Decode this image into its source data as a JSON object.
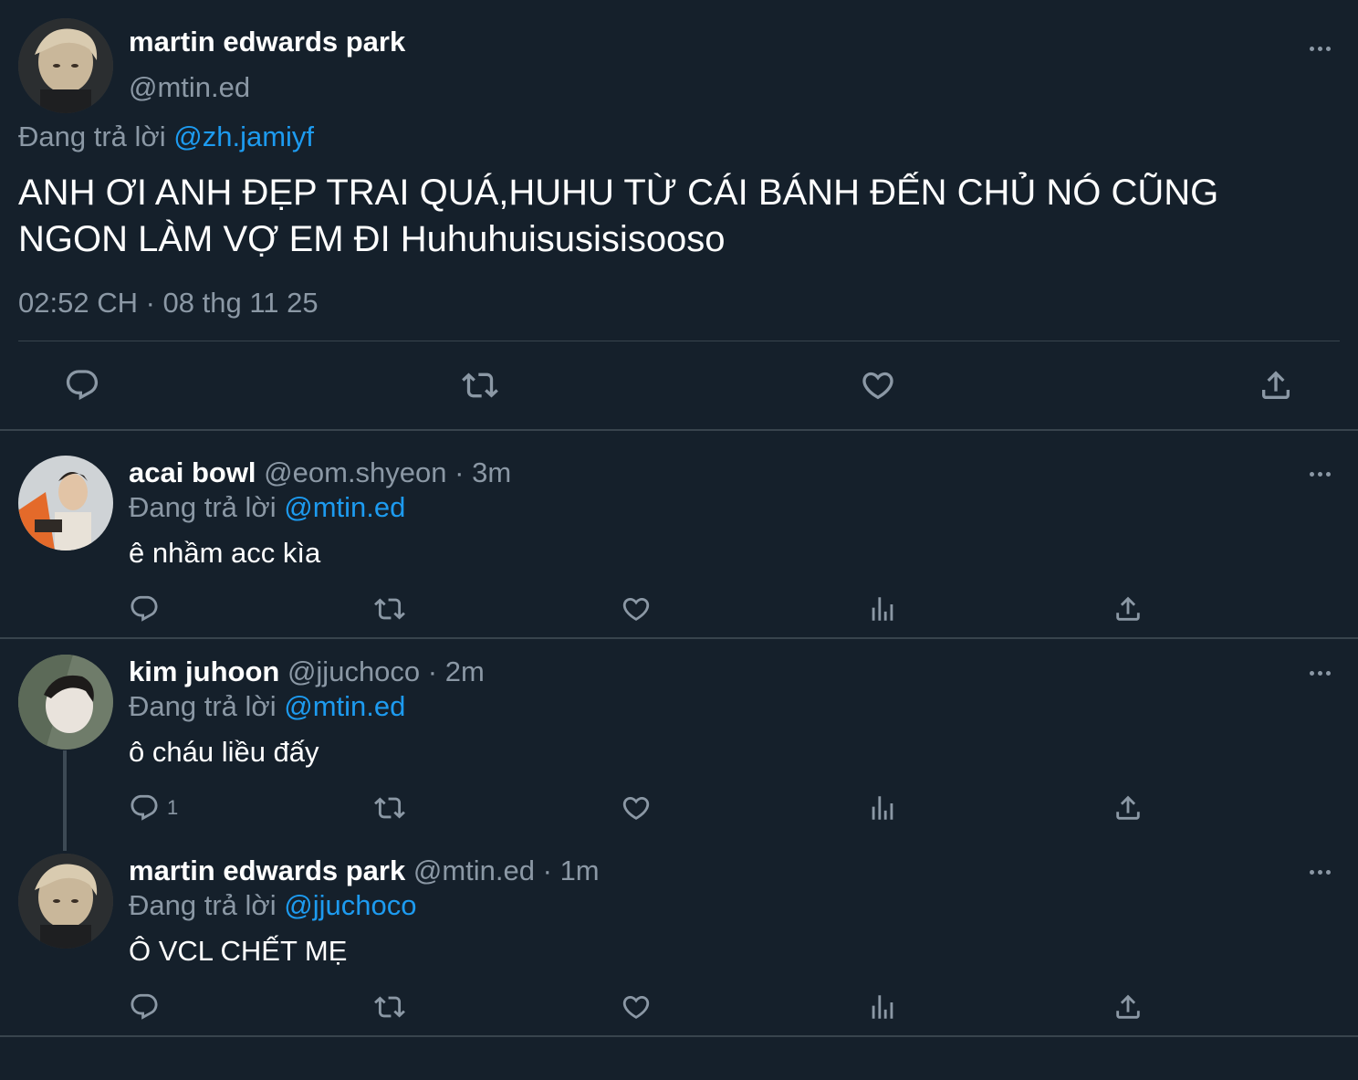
{
  "main_tweet": {
    "author_name": "martin edwards park",
    "author_handle": "@mtin.ed",
    "replying_prefix": "Đang trả lời",
    "replying_to": "@zh.jamiyf",
    "text": "ANH ƠI ANH ĐẸP TRAI QUÁ,HUHU TỪ CÁI BÁNH ĐẾN CHỦ NÓ CŨNG NGON LÀM VỢ EM ĐI Huhuhuisusisisooso",
    "timestamp": "02:52 CH · 08 thg 11 25",
    "actions": [
      "reply-icon",
      "retweet-icon",
      "like-icon",
      "share-icon"
    ]
  },
  "replies": [
    {
      "author_name": "acai bowl",
      "author_handle": "@eom.shyeon",
      "sep": "·",
      "age": "3m",
      "replying_prefix": "Đang trả lời",
      "replying_to": "@mtin.ed",
      "text": "ê nhầm acc kìa",
      "reply_count": ""
    },
    {
      "author_name": "kim juhoon",
      "author_handle": "@jjuchoco",
      "sep": "·",
      "age": "2m",
      "replying_prefix": "Đang trả lời",
      "replying_to": "@mtin.ed",
      "text": "ô cháu liều đấy",
      "reply_count": "1"
    },
    {
      "author_name": "martin edwards park",
      "author_handle": "@mtin.ed",
      "sep": "·",
      "age": "1m",
      "replying_prefix": "Đang trả lời",
      "replying_to": "@jjuchoco",
      "text": "Ô VCL CHẾT MẸ",
      "reply_count": ""
    }
  ],
  "colors": {
    "background": "#15202b",
    "text": "#ffffff",
    "muted": "#8b98a5",
    "link": "#1d9bf0",
    "divider": "#38444d"
  }
}
